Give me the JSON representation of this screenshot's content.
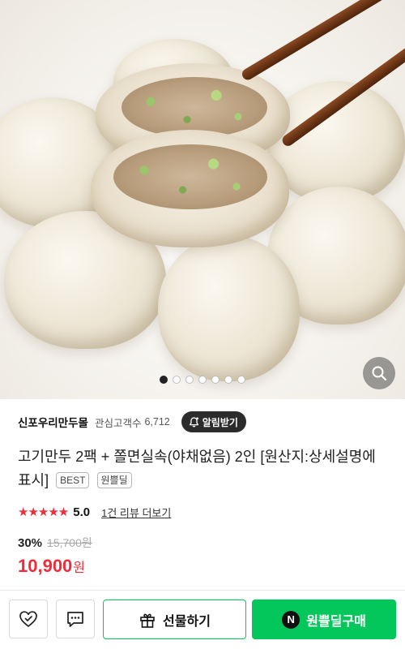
{
  "store": {
    "name": "신포우리만두몰",
    "interest_label": "관심고객수",
    "interest_count": "6,712",
    "alarm_label": "알림받기"
  },
  "product": {
    "title": "고기만두 2팩 + 쫄면실속(야채없음) 2인 [원산지:상세설명에 표시]",
    "tags": [
      "BEST",
      "원쁠딜"
    ],
    "image": {
      "slides_total": 7,
      "active_slide": 1
    }
  },
  "rating": {
    "stars": "★★★★★",
    "value": "5.0",
    "review_link": "1건 리뷰 더보기"
  },
  "price": {
    "discount": "30%",
    "original": "15,700원",
    "final": "10,900",
    "unit": "원"
  },
  "actions": {
    "gift_label": "선물하기",
    "buy_label": "원쁠딜구매",
    "buy_badge": "N"
  },
  "colors": {
    "accent_green": "#03c75a",
    "price_red": "#ef2d3a",
    "dark_button": "#2c2c2c"
  },
  "icons": {
    "wish": "heart-check-icon",
    "chat": "chat-bubble-icon",
    "gift": "gift-icon",
    "search": "magnifier-icon",
    "alarm": "bell-plus-icon"
  }
}
